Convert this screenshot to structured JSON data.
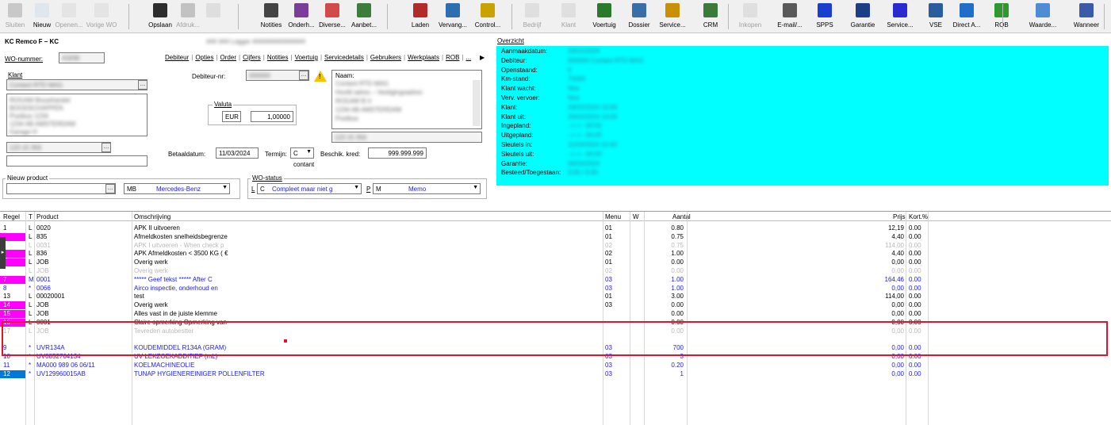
{
  "toolbar": {
    "buttons": [
      {
        "id": "sluiten",
        "label": "Sluiten",
        "icon": "close-icon",
        "enabled": false
      },
      {
        "id": "nieuw",
        "label": "Nieuw",
        "icon": "new-document-icon",
        "enabled": true
      },
      {
        "id": "openen",
        "label": "Openen...",
        "icon": "open-folder-icon",
        "enabled": false
      },
      {
        "id": "vorige_wo",
        "label": "Vorige WO",
        "icon": "previous-icon",
        "enabled": false
      },
      {
        "id": "opslaan",
        "label": "Opslaan",
        "icon": "save-icon",
        "enabled": true
      },
      {
        "id": "afdrukken",
        "label": "Afdruk...",
        "icon": "print-icon",
        "enabled": false
      },
      {
        "id": "blank1",
        "label": "",
        "icon": "bottle-icon",
        "enabled": false
      },
      {
        "id": "notities",
        "label": "Notities",
        "icon": "notes-icon",
        "enabled": true
      },
      {
        "id": "onderhoud",
        "label": "Onderh...",
        "icon": "maintenance-icon",
        "enabled": true
      },
      {
        "id": "diverse",
        "label": "Diverse...",
        "icon": "diverse-icon",
        "enabled": true
      },
      {
        "id": "aanbet",
        "label": "Aanbet...",
        "icon": "down-payment-icon",
        "enabled": true
      },
      {
        "id": "laden",
        "label": "Laden",
        "icon": "load-icon",
        "enabled": true
      },
      {
        "id": "vervang",
        "label": "Vervang...",
        "icon": "replace-icon",
        "enabled": true
      },
      {
        "id": "control",
        "label": "Control...",
        "icon": "key-icon",
        "enabled": true
      },
      {
        "id": "bedrijf",
        "label": "Bedrijf",
        "icon": "company-icon",
        "enabled": false
      },
      {
        "id": "klant",
        "label": "Klant",
        "icon": "customer-icon",
        "enabled": false
      },
      {
        "id": "voertuig",
        "label": "Voertuig",
        "icon": "vehicle-icon",
        "enabled": true
      },
      {
        "id": "dossier",
        "label": "Dossier",
        "icon": "dossier-icon",
        "enabled": true
      },
      {
        "id": "service",
        "label": "Service...",
        "icon": "service-icon",
        "enabled": true
      },
      {
        "id": "crm",
        "label": "CRM",
        "icon": "crm-icon",
        "enabled": true
      },
      {
        "id": "inkopen",
        "label": "Inkopen",
        "icon": "purchase-icon",
        "enabled": false
      },
      {
        "id": "email",
        "label": "E-mail/...",
        "icon": "email-icon",
        "enabled": true
      },
      {
        "id": "spps",
        "label": "SPPS",
        "icon": "spps-icon",
        "enabled": true
      },
      {
        "id": "garantie",
        "label": "Garantie",
        "icon": "warranty-icon",
        "enabled": true
      },
      {
        "id": "service2",
        "label": "Service...",
        "icon": "kdm-icon",
        "enabled": true
      },
      {
        "id": "vse",
        "label": "VSE",
        "icon": "vse-icon",
        "enabled": true
      },
      {
        "id": "direct",
        "label": "Direct A...",
        "icon": "direct-icon",
        "enabled": true
      },
      {
        "id": "rob",
        "label": "ROB",
        "icon": "rob-icon",
        "enabled": true
      },
      {
        "id": "waarde",
        "label": "Waarde...",
        "icon": "value-icon",
        "enabled": true
      },
      {
        "id": "wanneer",
        "label": "Wanneer",
        "icon": "calendar-icon",
        "enabled": true
      }
    ]
  },
  "header": {
    "title": "KC  Remco F – KC",
    "title_blurred": "### ### Logger ###############",
    "wo_label": "WO-nummer:",
    "wo_value": "41836",
    "klant_label": "Klant",
    "klant_value": "Contant RTD MAG",
    "address_lines": [
      "ROGAM Bouwhandel",
      "BOODSCHAPPEN",
      "Postbus 1234",
      "1234 AB  AMSTERDAM",
      "Garage                H"
    ],
    "phone_value": "123 15 356",
    "debiteur_label": "Debiteur-nr:",
    "debiteur_value": "000000",
    "naam_label": "Naam:",
    "naam_lines": [
      "Contant RTD MAG",
      "Hoofd adres – Vestigingsadres:",
      "ROGAM B.V.",
      "1234 AB  AMSTERDAM",
      "Postbus"
    ],
    "naam_phone": "123 15 356",
    "valuta_label": "Valuta",
    "valuta_code": "EUR",
    "valuta_rate": "1,00000",
    "betaaldatum_label": "Betaaldatum:",
    "betaaldatum_value": "11/03/2024",
    "termijn_label": "Termijn:",
    "termijn_value": "C",
    "contant_label": "contant",
    "beschik_label": "Beschik. kred:",
    "beschik_value": "999.999.999",
    "tabs": [
      "Debiteur",
      "Opties",
      "Order",
      "Cijfers",
      "Notities",
      "Voertuig",
      "Servicedetails",
      "Gebruikers",
      "Werkplaats",
      "ROB",
      "..."
    ],
    "nieuw_product_label": "Nieuw product",
    "product_merk_code": "MB",
    "product_merk_name": "Mercedes-Benz",
    "wo_status_label": "WO-status",
    "status_code1": "L",
    "status_code2": "C",
    "status_text": "Compleet maar niet g",
    "memo_code1": "P",
    "memo_code2": "M",
    "memo_text": "Memo"
  },
  "overview": {
    "title": "Overzicht",
    "rows": [
      {
        "k": "Aanmaakdatum:",
        "v": "29/02/2024"
      },
      {
        "k": "Debiteur:",
        "v": "000000 Contant RTD MAG"
      },
      {
        "k": "Openstaand:",
        "v": "0"
      },
      {
        "k": "Km-stand:",
        "v": "75000"
      },
      {
        "k": "Klant wacht:",
        "v": "Nee"
      },
      {
        "k": "Verv. vervoer:",
        "v": "Nee"
      },
      {
        "k": "Klant:",
        "v": "29/02/2024 10:00"
      },
      {
        "k": "Klant uit:",
        "v": "29/02/2024 14:00"
      },
      {
        "k": "Ingepland:",
        "v": "--/--/-- 00:00"
      },
      {
        "k": "Uitgepland:",
        "v": "--/--/-- 00:00"
      },
      {
        "k": "Sleutels in:",
        "v": "11/03/2024 10:43"
      },
      {
        "k": "Sleutels uit:",
        "v": "--/--/-- 00:00"
      },
      {
        "k": "Garantie:",
        "v": "06/03/2024"
      },
      {
        "k": "Besteed/Toegestaan:",
        "v": "0:00 / 0:00"
      }
    ]
  },
  "grid": {
    "headers": {
      "regel": "Regel",
      "t": "T",
      "product": "Product",
      "omschrijving": "Omschrijving",
      "menu": "Menu",
      "w": "W",
      "aantal": "Aantal",
      "prijs": "Prijs",
      "korting": "Kort.%"
    },
    "rows": [
      {
        "regel": "1",
        "t": "L",
        "product": "0020",
        "omschrijving": "APK II uitvoeren",
        "menu": "01",
        "aantal": "0.80",
        "prijs": "12,19",
        "korting": "0.00",
        "style": "normal",
        "mark": ""
      },
      {
        "regel": "",
        "t": "L",
        "product": "835",
        "omschrijving": "Afmeldkosten snelheidsbegrenze",
        "menu": "01",
        "aantal": "0.75",
        "prijs": "4,40",
        "korting": "0.00",
        "style": "normal",
        "mark": "#ff00ff"
      },
      {
        "regel": "",
        "t": "L",
        "product": "0031",
        "omschrijving": "APK I uitvoeren - When check p",
        "menu": "02",
        "aantal": "0.75",
        "prijs": "114,00",
        "korting": "0.00",
        "style": "faded",
        "mark": ""
      },
      {
        "regel": "",
        "t": "L",
        "product": "836",
        "omschrijving": "APK Afmeldkosten < 3500 KG ( €",
        "menu": "02",
        "aantal": "1.00",
        "prijs": "4,40",
        "korting": "0.00",
        "style": "normal",
        "mark": "#ff00ff"
      },
      {
        "regel": "",
        "t": "L",
        "product": "JOB",
        "omschrijving": "Overig werk",
        "menu": "01",
        "aantal": "0.00",
        "prijs": "0,00",
        "korting": "0.00",
        "style": "normal",
        "mark": "#ff00ff"
      },
      {
        "regel": "",
        "t": "L",
        "product": "JOB",
        "omschrijving": "Overig werk",
        "menu": "02",
        "aantal": "0.00",
        "prijs": "0,00",
        "korting": "0.00",
        "style": "faded",
        "mark": ""
      },
      {
        "regel": "7",
        "t": "M",
        "product": "0001",
        "omschrijving": "***** Geef tekst ***** After C",
        "menu": "03",
        "aantal": "1.00",
        "prijs": "164,46",
        "korting": "0.00",
        "style": "blue",
        "mark": "#ff00ff"
      },
      {
        "regel": "8",
        "t": "*",
        "product": "0066",
        "omschrijving": "Airco inspectie, onderhoud en",
        "menu": "03",
        "aantal": "1.00",
        "prijs": "0,00",
        "korting": "0.00",
        "style": "blue",
        "mark": ""
      },
      {
        "regel": "13",
        "t": "L",
        "product": "00020001",
        "omschrijving": "test",
        "menu": "01",
        "aantal": "3.00",
        "prijs": "114,00",
        "korting": "0.00",
        "style": "normal",
        "mark": ""
      },
      {
        "regel": "14",
        "t": "L",
        "product": "JOB",
        "omschrijving": "Overig werk",
        "menu": "03",
        "aantal": "0.00",
        "prijs": "0,00",
        "korting": "0.00",
        "style": "normal",
        "mark": "#ff00ff"
      },
      {
        "regel": "15",
        "t": "L",
        "product": "JOB",
        "omschrijving": "Alles vast in de juiste klemme",
        "menu": "",
        "aantal": "0.00",
        "prijs": "0,00",
        "korting": "0.00",
        "style": "normal",
        "mark": "#ff00ff"
      },
      {
        "regel": "16",
        "t": "L",
        "product": "0001",
        "omschrijving": "Claire opmerking Opmerking van",
        "menu": "",
        "aantal": "0.00",
        "prijs": "0,00",
        "korting": "0.00",
        "style": "normal",
        "mark": "#ff00ff"
      },
      {
        "regel": "17",
        "t": "L",
        "product": "JOB",
        "omschrijving": "Tevreden autobestter",
        "menu": "",
        "aantal": "0.00",
        "prijs": "0,00",
        "korting": "0.00",
        "style": "faded",
        "mark": ""
      },
      {
        "regel": "",
        "t": "",
        "product": "",
        "omschrijving": "",
        "menu": "",
        "aantal": "",
        "prijs": "",
        "korting": "",
        "style": "empty",
        "mark": ""
      },
      {
        "regel": "9",
        "t": "*",
        "product": "UVR134A",
        "omschrijving": "KOUDEMIDDEL R134A (GRAM)",
        "menu": "03",
        "aantal": "700",
        "prijs": "0,00",
        "korting": "0.00",
        "style": "blue",
        "mark": ""
      },
      {
        "regel": "10",
        "t": "*",
        "product": "UV0852764134",
        "omschrijving": "UV  LEKZOEKADDITIEF (mL)",
        "menu": "03",
        "aantal": "3",
        "prijs": "0,00",
        "korting": "0.00",
        "style": "blue",
        "mark": ""
      },
      {
        "regel": "11",
        "t": "*",
        "product": "MA000 989 06 06/11",
        "omschrijving": "KOELMACHINEOLIE",
        "menu": "03",
        "aantal": "0.20",
        "prijs": "0,00",
        "korting": "0.00",
        "style": "blue",
        "mark": ""
      },
      {
        "regel": "12",
        "t": "*",
        "product": "UV129960015AB",
        "omschrijving": "TUNAP HYGIENEREINIGER POLLENFILTER",
        "menu": "03",
        "aantal": "1",
        "prijs": "0,00",
        "korting": "0.00",
        "style": "blue",
        "mark": "#0078d7"
      }
    ]
  },
  "colors": {
    "overview_bg": "#00ffff",
    "mark_magenta": "#ff00ff",
    "mark_blue": "#0078d7",
    "selection_red": "#e8102a",
    "text_blue": "#1a1aff"
  }
}
